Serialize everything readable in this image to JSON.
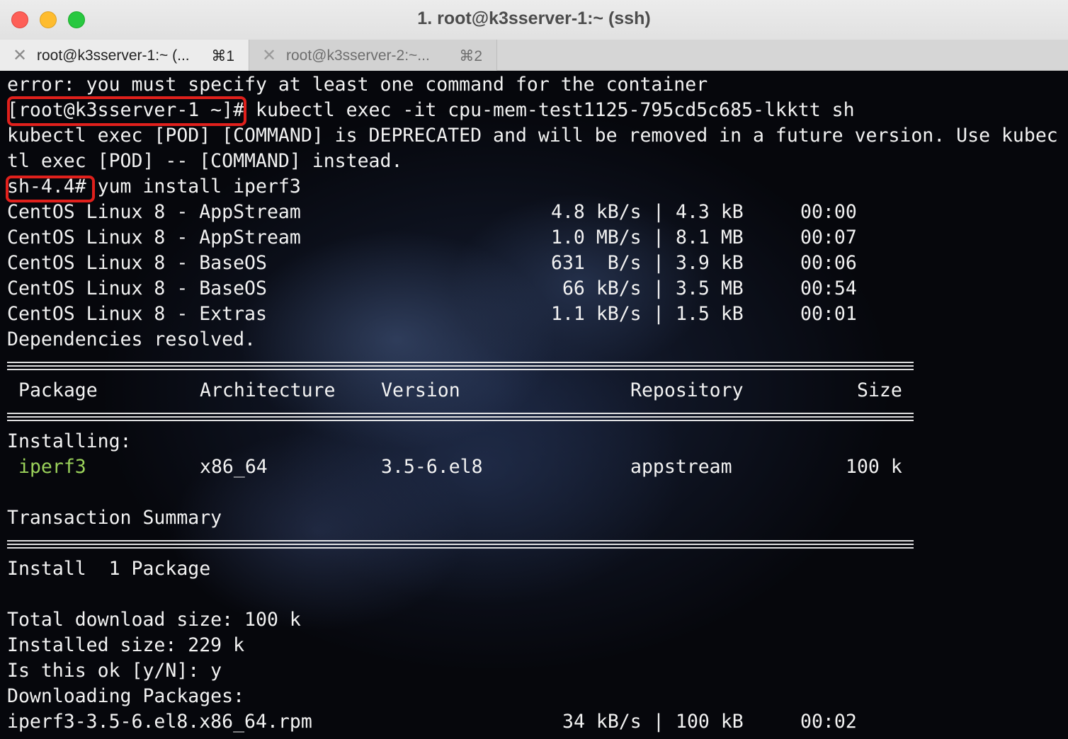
{
  "window": {
    "title": "1. root@k3sserver-1:~ (ssh)"
  },
  "tabs": [
    {
      "label": "root@k3sserver-1:~ (...",
      "shortcut": "⌘1",
      "active": true
    },
    {
      "label": "root@k3sserver-2:~...",
      "shortcut": "⌘2",
      "active": false
    }
  ],
  "terminal": {
    "error_line": "error: you must specify at least one command for the container",
    "prompt1": "[root@k3sserver-1 ~]#",
    "cmd1": " kubectl exec -it cpu-mem-test1125-795cd5c685-lkktt sh",
    "deprecated1": "kubectl exec [POD] [COMMAND] is DEPRECATED and will be removed in a future version. Use kubec",
    "deprecated2": "tl exec [POD] -- [COMMAND] instead.",
    "prompt2": "sh-4.4#",
    "cmd2": " yum install iperf3",
    "repos": [
      {
        "name": "CentOS Linux 8 - AppStream",
        "speed": "4.8 kB/s",
        "sep": "|",
        "size": "4.3 kB",
        "time": "00:00"
      },
      {
        "name": "CentOS Linux 8 - AppStream",
        "speed": "1.0 MB/s",
        "sep": "|",
        "size": "8.1 MB",
        "time": "00:07"
      },
      {
        "name": "CentOS Linux 8 - BaseOS",
        "speed": "631  B/s",
        "sep": "|",
        "size": "3.9 kB",
        "time": "00:06"
      },
      {
        "name": "CentOS Linux 8 - BaseOS",
        "speed": " 66 kB/s",
        "sep": "|",
        "size": "3.5 MB",
        "time": "00:54"
      },
      {
        "name": "CentOS Linux 8 - Extras",
        "speed": "1.1 kB/s",
        "sep": "|",
        "size": "1.5 kB",
        "time": "00:01"
      }
    ],
    "deps_resolved": "Dependencies resolved.",
    "table_headers": {
      "package": "Package",
      "architecture": "Architecture",
      "version": "Version",
      "repository": "Repository",
      "size": "Size"
    },
    "installing_label": "Installing:",
    "package_row": {
      "package": "iperf3",
      "architecture": "x86_64",
      "version": "3.5-6.el8",
      "repository": "appstream",
      "size": "100 k"
    },
    "transaction_summary": "Transaction Summary",
    "install_line": "Install  1 Package",
    "total_download": "Total download size: 100 k",
    "installed_size": "Installed size: 229 k",
    "confirm": "Is this ok [y/N]: y",
    "downloading": "Downloading Packages:",
    "download_row": {
      "file": "iperf3-3.5-6.el8.x86_64.rpm",
      "speed": "34 kB/s",
      "sep": "|",
      "size": "100 kB",
      "time": "00:02"
    }
  },
  "colors": {
    "highlight": "#e0201c",
    "package_name": "#9ad15a",
    "terminal_text": "#f2f2f2"
  }
}
